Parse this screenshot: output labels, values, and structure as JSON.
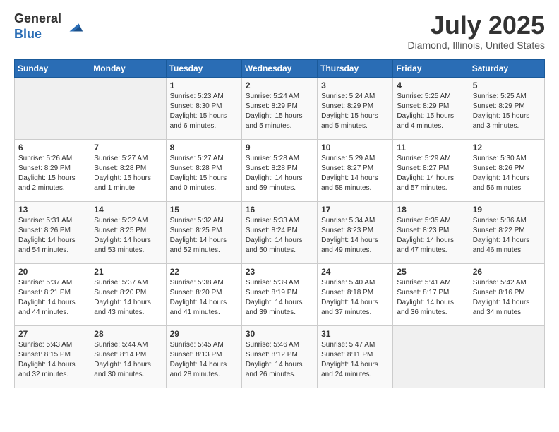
{
  "logo": {
    "general": "General",
    "blue": "Blue"
  },
  "title": {
    "month_year": "July 2025",
    "location": "Diamond, Illinois, United States"
  },
  "days_of_week": [
    "Sunday",
    "Monday",
    "Tuesday",
    "Wednesday",
    "Thursday",
    "Friday",
    "Saturday"
  ],
  "weeks": [
    [
      {
        "day": "",
        "info": ""
      },
      {
        "day": "",
        "info": ""
      },
      {
        "day": "1",
        "info": "Sunrise: 5:23 AM\nSunset: 8:30 PM\nDaylight: 15 hours and 6 minutes."
      },
      {
        "day": "2",
        "info": "Sunrise: 5:24 AM\nSunset: 8:29 PM\nDaylight: 15 hours and 5 minutes."
      },
      {
        "day": "3",
        "info": "Sunrise: 5:24 AM\nSunset: 8:29 PM\nDaylight: 15 hours and 5 minutes."
      },
      {
        "day": "4",
        "info": "Sunrise: 5:25 AM\nSunset: 8:29 PM\nDaylight: 15 hours and 4 minutes."
      },
      {
        "day": "5",
        "info": "Sunrise: 5:25 AM\nSunset: 8:29 PM\nDaylight: 15 hours and 3 minutes."
      }
    ],
    [
      {
        "day": "6",
        "info": "Sunrise: 5:26 AM\nSunset: 8:29 PM\nDaylight: 15 hours and 2 minutes."
      },
      {
        "day": "7",
        "info": "Sunrise: 5:27 AM\nSunset: 8:28 PM\nDaylight: 15 hours and 1 minute."
      },
      {
        "day": "8",
        "info": "Sunrise: 5:27 AM\nSunset: 8:28 PM\nDaylight: 15 hours and 0 minutes."
      },
      {
        "day": "9",
        "info": "Sunrise: 5:28 AM\nSunset: 8:28 PM\nDaylight: 14 hours and 59 minutes."
      },
      {
        "day": "10",
        "info": "Sunrise: 5:29 AM\nSunset: 8:27 PM\nDaylight: 14 hours and 58 minutes."
      },
      {
        "day": "11",
        "info": "Sunrise: 5:29 AM\nSunset: 8:27 PM\nDaylight: 14 hours and 57 minutes."
      },
      {
        "day": "12",
        "info": "Sunrise: 5:30 AM\nSunset: 8:26 PM\nDaylight: 14 hours and 56 minutes."
      }
    ],
    [
      {
        "day": "13",
        "info": "Sunrise: 5:31 AM\nSunset: 8:26 PM\nDaylight: 14 hours and 54 minutes."
      },
      {
        "day": "14",
        "info": "Sunrise: 5:32 AM\nSunset: 8:25 PM\nDaylight: 14 hours and 53 minutes."
      },
      {
        "day": "15",
        "info": "Sunrise: 5:32 AM\nSunset: 8:25 PM\nDaylight: 14 hours and 52 minutes."
      },
      {
        "day": "16",
        "info": "Sunrise: 5:33 AM\nSunset: 8:24 PM\nDaylight: 14 hours and 50 minutes."
      },
      {
        "day": "17",
        "info": "Sunrise: 5:34 AM\nSunset: 8:23 PM\nDaylight: 14 hours and 49 minutes."
      },
      {
        "day": "18",
        "info": "Sunrise: 5:35 AM\nSunset: 8:23 PM\nDaylight: 14 hours and 47 minutes."
      },
      {
        "day": "19",
        "info": "Sunrise: 5:36 AM\nSunset: 8:22 PM\nDaylight: 14 hours and 46 minutes."
      }
    ],
    [
      {
        "day": "20",
        "info": "Sunrise: 5:37 AM\nSunset: 8:21 PM\nDaylight: 14 hours and 44 minutes."
      },
      {
        "day": "21",
        "info": "Sunrise: 5:37 AM\nSunset: 8:20 PM\nDaylight: 14 hours and 43 minutes."
      },
      {
        "day": "22",
        "info": "Sunrise: 5:38 AM\nSunset: 8:20 PM\nDaylight: 14 hours and 41 minutes."
      },
      {
        "day": "23",
        "info": "Sunrise: 5:39 AM\nSunset: 8:19 PM\nDaylight: 14 hours and 39 minutes."
      },
      {
        "day": "24",
        "info": "Sunrise: 5:40 AM\nSunset: 8:18 PM\nDaylight: 14 hours and 37 minutes."
      },
      {
        "day": "25",
        "info": "Sunrise: 5:41 AM\nSunset: 8:17 PM\nDaylight: 14 hours and 36 minutes."
      },
      {
        "day": "26",
        "info": "Sunrise: 5:42 AM\nSunset: 8:16 PM\nDaylight: 14 hours and 34 minutes."
      }
    ],
    [
      {
        "day": "27",
        "info": "Sunrise: 5:43 AM\nSunset: 8:15 PM\nDaylight: 14 hours and 32 minutes."
      },
      {
        "day": "28",
        "info": "Sunrise: 5:44 AM\nSunset: 8:14 PM\nDaylight: 14 hours and 30 minutes."
      },
      {
        "day": "29",
        "info": "Sunrise: 5:45 AM\nSunset: 8:13 PM\nDaylight: 14 hours and 28 minutes."
      },
      {
        "day": "30",
        "info": "Sunrise: 5:46 AM\nSunset: 8:12 PM\nDaylight: 14 hours and 26 minutes."
      },
      {
        "day": "31",
        "info": "Sunrise: 5:47 AM\nSunset: 8:11 PM\nDaylight: 14 hours and 24 minutes."
      },
      {
        "day": "",
        "info": ""
      },
      {
        "day": "",
        "info": ""
      }
    ]
  ]
}
